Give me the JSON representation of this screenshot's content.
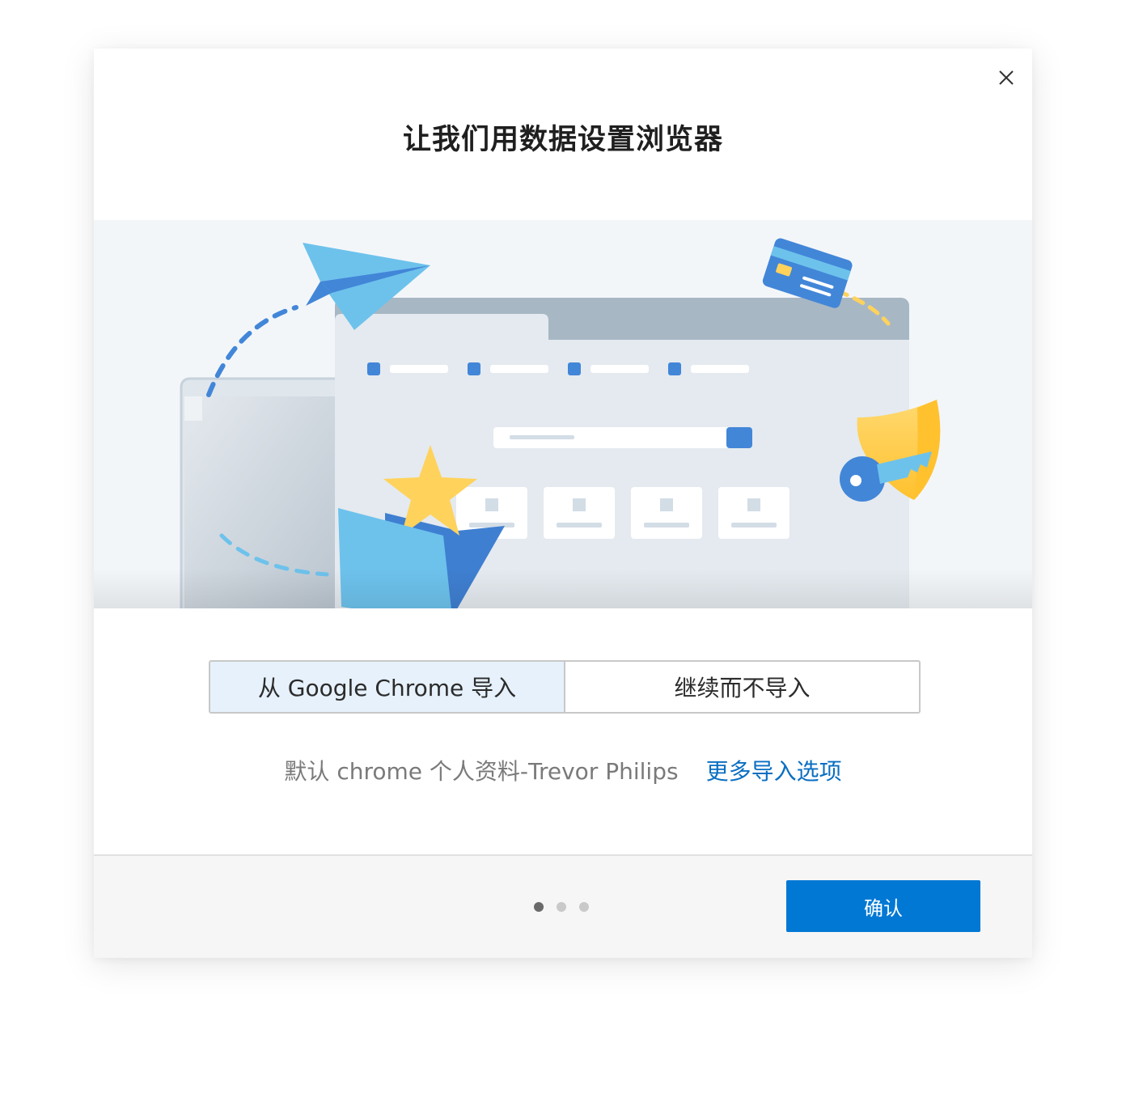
{
  "dialog": {
    "title": "让我们用数据设置浏览器",
    "close_icon": "close-icon"
  },
  "import_choice": {
    "options": [
      {
        "label": "从 Google Chrome 导入",
        "selected": true
      },
      {
        "label": "继续而不导入",
        "selected": false
      }
    ]
  },
  "profile": {
    "text": "默认 chrome 个人资料-Trevor Philips",
    "more_options_link": "更多导入选项"
  },
  "footer": {
    "page_dots": {
      "count": 3,
      "active_index": 0
    },
    "confirm_label": "确认"
  },
  "colors": {
    "accent": "#0078d4",
    "link": "#0a6fc2",
    "selected_option_bg": "#e6f1fb"
  }
}
